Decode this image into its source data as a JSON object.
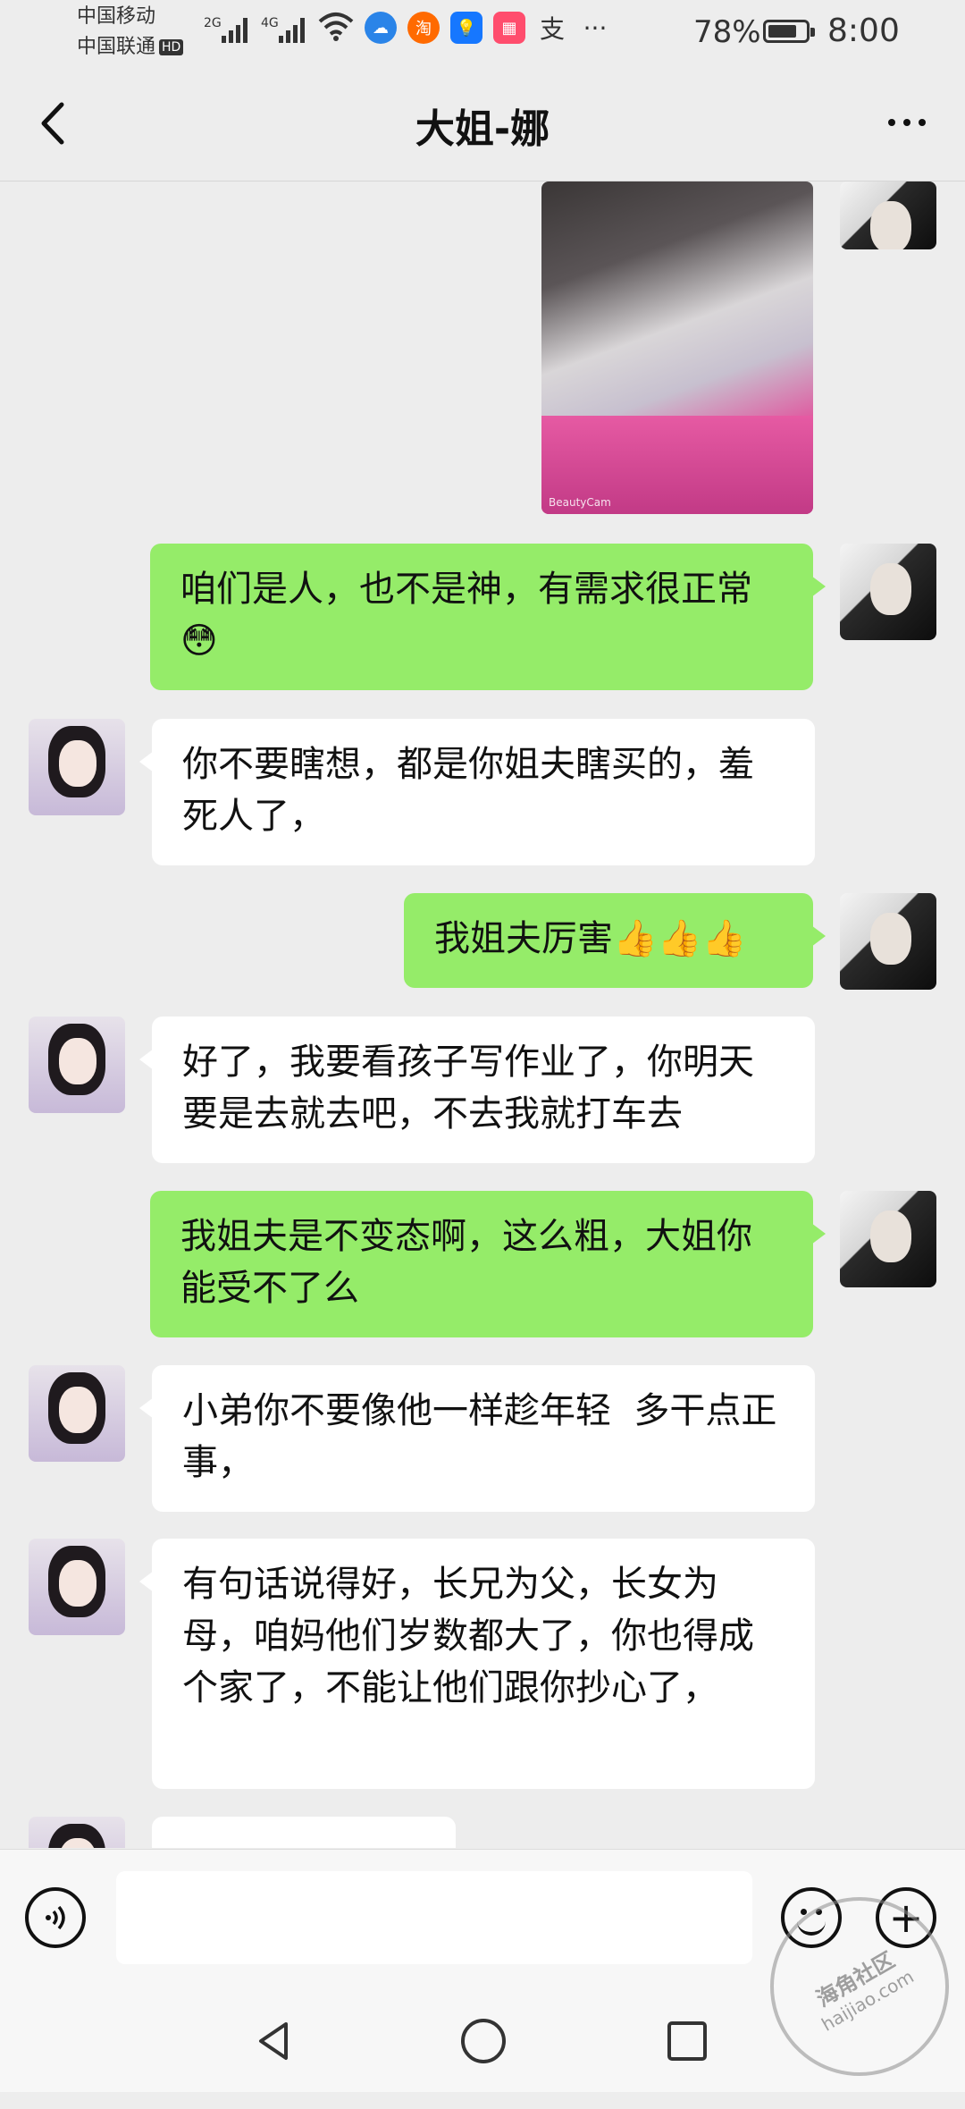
{
  "status_bar": {
    "carrier_1": "中国移动",
    "carrier_2": "中国联通",
    "hd": "HD",
    "net_1": "2G",
    "net_2": "4G",
    "battery": "78%",
    "battery_level": 0.78,
    "time": "8:00",
    "app_icons": [
      "cloud-icon",
      "taobao-icon",
      "bulb-icon",
      "wallet-icon",
      "alipay-icon",
      "more-dots-icon"
    ]
  },
  "header": {
    "title": "大姐-娜"
  },
  "messages": [
    {
      "side": "right",
      "type": "image",
      "watermark": "BeautyCam"
    },
    {
      "side": "right",
      "type": "text",
      "text": "咱们是人，也不是神，有需求很正常😳"
    },
    {
      "side": "left",
      "type": "text",
      "text": "你不要瞎想，都是你姐夫瞎买的，羞死人了，"
    },
    {
      "side": "right",
      "type": "text",
      "text": "我姐夫厉害👍👍👍"
    },
    {
      "side": "left",
      "type": "text",
      "text": "好了，我要看孩子写作业了，你明天要是去就去吧，不去我就打车去"
    },
    {
      "side": "right",
      "type": "text",
      "text": "我姐夫是不变态啊，这么粗，大姐你能受不了么"
    },
    {
      "side": "left",
      "type": "text",
      "text": "小弟你不要像他一样趁年轻  多干点正事，"
    },
    {
      "side": "left",
      "type": "text",
      "text": "有句话说得好，长兄为父，长女为母，咱妈他们岁数都大了，你也得成个家了，不能让他们跟你抄心了，"
    },
    {
      "side": "left",
      "type": "text",
      "text": ""
    }
  ],
  "input_bar": {
    "voice_icon": "voice-icon",
    "emoji_icon": "emoji-icon",
    "plus_icon": "plus-icon",
    "text_value": ""
  },
  "nav_bar": {
    "back_icon": "triangle-back-icon",
    "home_icon": "circle-home-icon",
    "recent_icon": "square-recent-icon"
  },
  "stamp": {
    "line_1": "海角社区",
    "line_2": "haijiao.com"
  }
}
